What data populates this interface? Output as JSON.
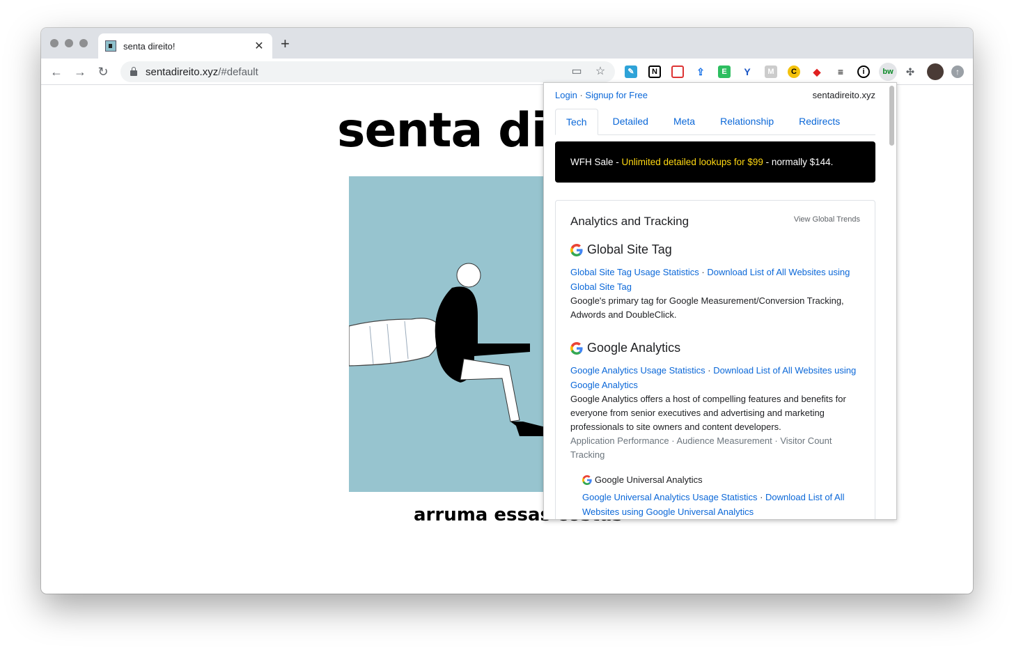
{
  "browser": {
    "tab_title": "senta direito!",
    "tab_close": "✕",
    "new_tab": "+",
    "url_host": "sentadireito.xyz",
    "url_path": "/#default"
  },
  "page": {
    "heading": "senta di",
    "caption": "arruma essas costas"
  },
  "popup": {
    "login": "Login",
    "separator": "·",
    "signup": "Signup for Free",
    "domain": "sentadireito.xyz",
    "tabs": [
      "Tech",
      "Detailed",
      "Meta",
      "Relationship",
      "Redirects"
    ],
    "banner": {
      "prefix": "WFH Sale - ",
      "highlight": "Unlimited detailed lookups for $99",
      "suffix": " - normally $144."
    },
    "section": {
      "title": "Analytics and Tracking",
      "trends": "View Global Trends",
      "techs": [
        {
          "name": "Global Site Tag",
          "usage_link": "Global Site Tag Usage Statistics",
          "download_link": "Download List of All Websites using Global Site Tag",
          "description": "Google's primary tag for Google Measurement/Conversion Tracking, Adwords and DoubleClick."
        },
        {
          "name": "Google Analytics",
          "usage_link": "Google Analytics Usage Statistics",
          "download_link": "Download List of All Websites using Google Analytics",
          "description": "Google Analytics offers a host of compelling features and benefits for everyone from senior executives and advertising and marketing professionals to site owners and content developers.",
          "tags": "Application Performance · Audience Measurement · Visitor Count Tracking"
        },
        {
          "name": "Google Universal Analytics",
          "usage_link": "Google Universal Analytics Usage Statistics",
          "download_link": "Download List of All Websites using Google Universal Analytics"
        }
      ]
    }
  }
}
